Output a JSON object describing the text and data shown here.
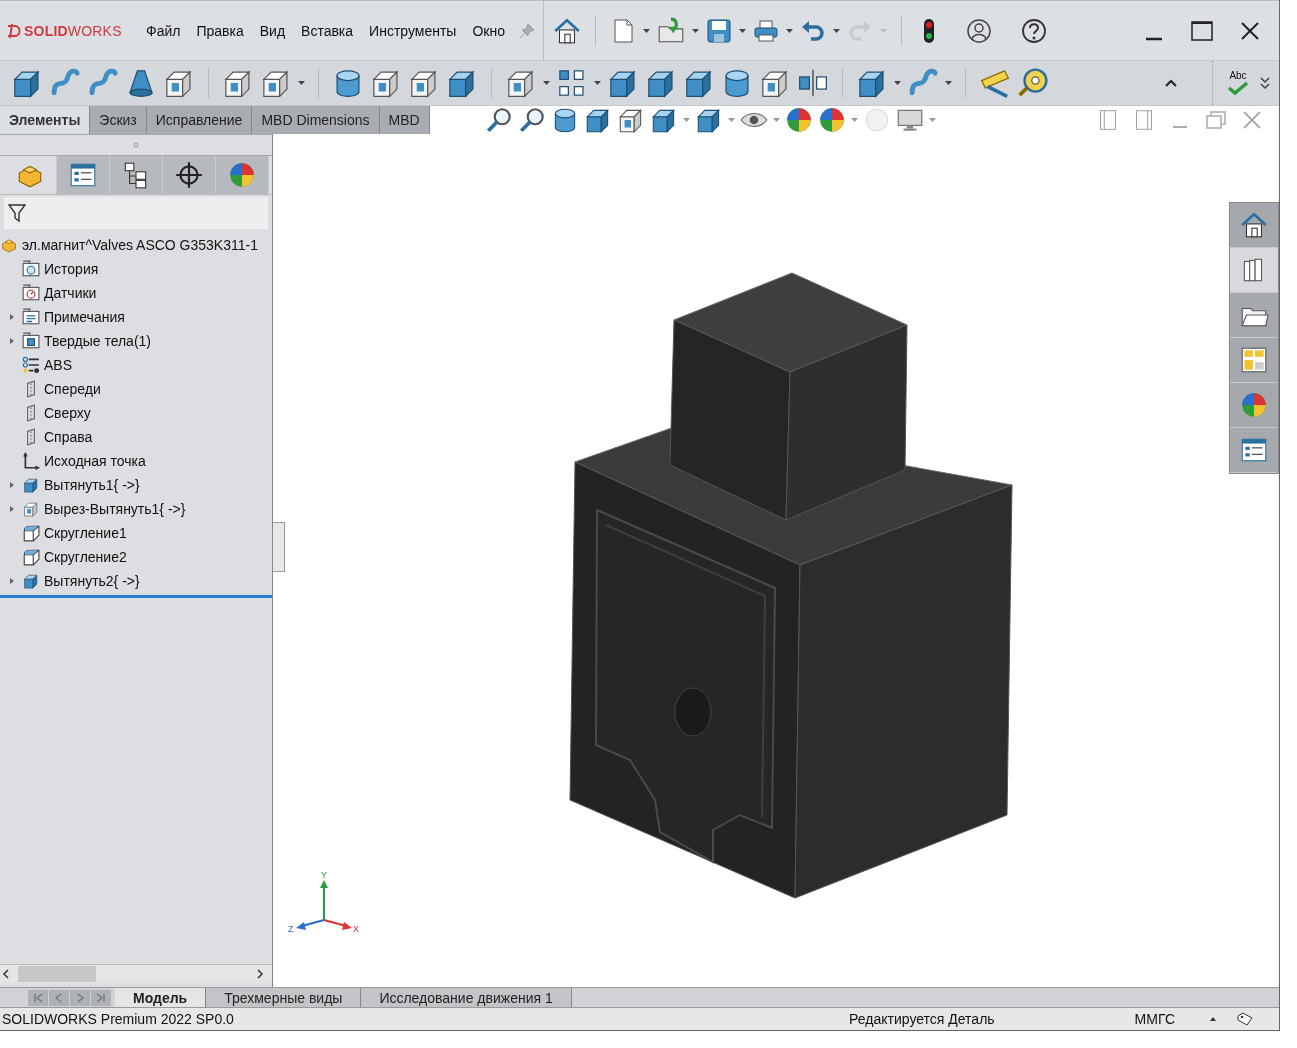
{
  "logo": {
    "text": "**SOLID**WORKS"
  },
  "menu": [
    "Файл",
    "Правка",
    "Вид",
    "Вставка",
    "Инструменты",
    "Окно"
  ],
  "command_tabs": [
    {
      "label": "Элементы",
      "selected": true
    },
    {
      "label": "Эскиз",
      "selected": false
    },
    {
      "label": "Исправление",
      "selected": false
    },
    {
      "label": "MBD Dimensions",
      "selected": false
    },
    {
      "label": "MBD",
      "selected": false
    }
  ],
  "spellcheck": {
    "label": "Abc"
  },
  "panel_tabs": [
    {
      "kind": "features",
      "selected": true
    },
    {
      "kind": "properties",
      "selected": false
    },
    {
      "kind": "configurations",
      "selected": false
    },
    {
      "kind": "dimxpert",
      "selected": false
    },
    {
      "kind": "display",
      "selected": false
    }
  ],
  "tree": {
    "root": {
      "label": "эл.магнит^Valves ASCO G353K311-1",
      "kind": "part"
    },
    "items": [
      {
        "label": "История",
        "kind": "history",
        "has_children": false
      },
      {
        "label": "Датчики",
        "kind": "sensors",
        "has_children": false
      },
      {
        "label": "Примечания",
        "kind": "annotations",
        "has_children": true
      },
      {
        "label": "Твердые тела(1)",
        "kind": "bodies",
        "has_children": true
      },
      {
        "label": "ABS",
        "kind": "material",
        "has_children": false
      },
      {
        "label": "Спереди",
        "kind": "plane",
        "has_children": false
      },
      {
        "label": "Сверху",
        "kind": "plane",
        "has_children": false
      },
      {
        "label": "Справа",
        "kind": "plane",
        "has_children": false
      },
      {
        "label": "Исходная точка",
        "kind": "origin",
        "has_children": false
      },
      {
        "label": "Вытянуть1{ ->}",
        "kind": "extrude",
        "has_children": true
      },
      {
        "label": "Вырез-Вытянуть1{ ->}",
        "kind": "cut",
        "has_children": true
      },
      {
        "label": "Скругление1",
        "kind": "fillet",
        "has_children": false
      },
      {
        "label": "Скругление2",
        "kind": "fillet",
        "has_children": false
      },
      {
        "label": "Вытянуть2{ ->}",
        "kind": "extrude",
        "has_children": true
      }
    ]
  },
  "triad": {
    "x": "X",
    "y": "Y",
    "z": "Z"
  },
  "task_pane": [
    {
      "kind": "home",
      "selected": false
    },
    {
      "kind": "library",
      "selected": true
    },
    {
      "kind": "explorer",
      "selected": false
    },
    {
      "kind": "view_palette",
      "selected": false
    },
    {
      "kind": "appearances",
      "selected": false
    },
    {
      "kind": "properties",
      "selected": false
    }
  ],
  "bottom_tabs": [
    {
      "label": "Модель",
      "selected": true
    },
    {
      "label": "Трехмерные виды",
      "selected": false
    },
    {
      "label": "Исследование движения 1",
      "selected": false
    }
  ],
  "status_bar": {
    "product": "SOLIDWORKS Premium 2022 SP0.0",
    "mode": "Редактируется Деталь",
    "units": "ММГС"
  }
}
